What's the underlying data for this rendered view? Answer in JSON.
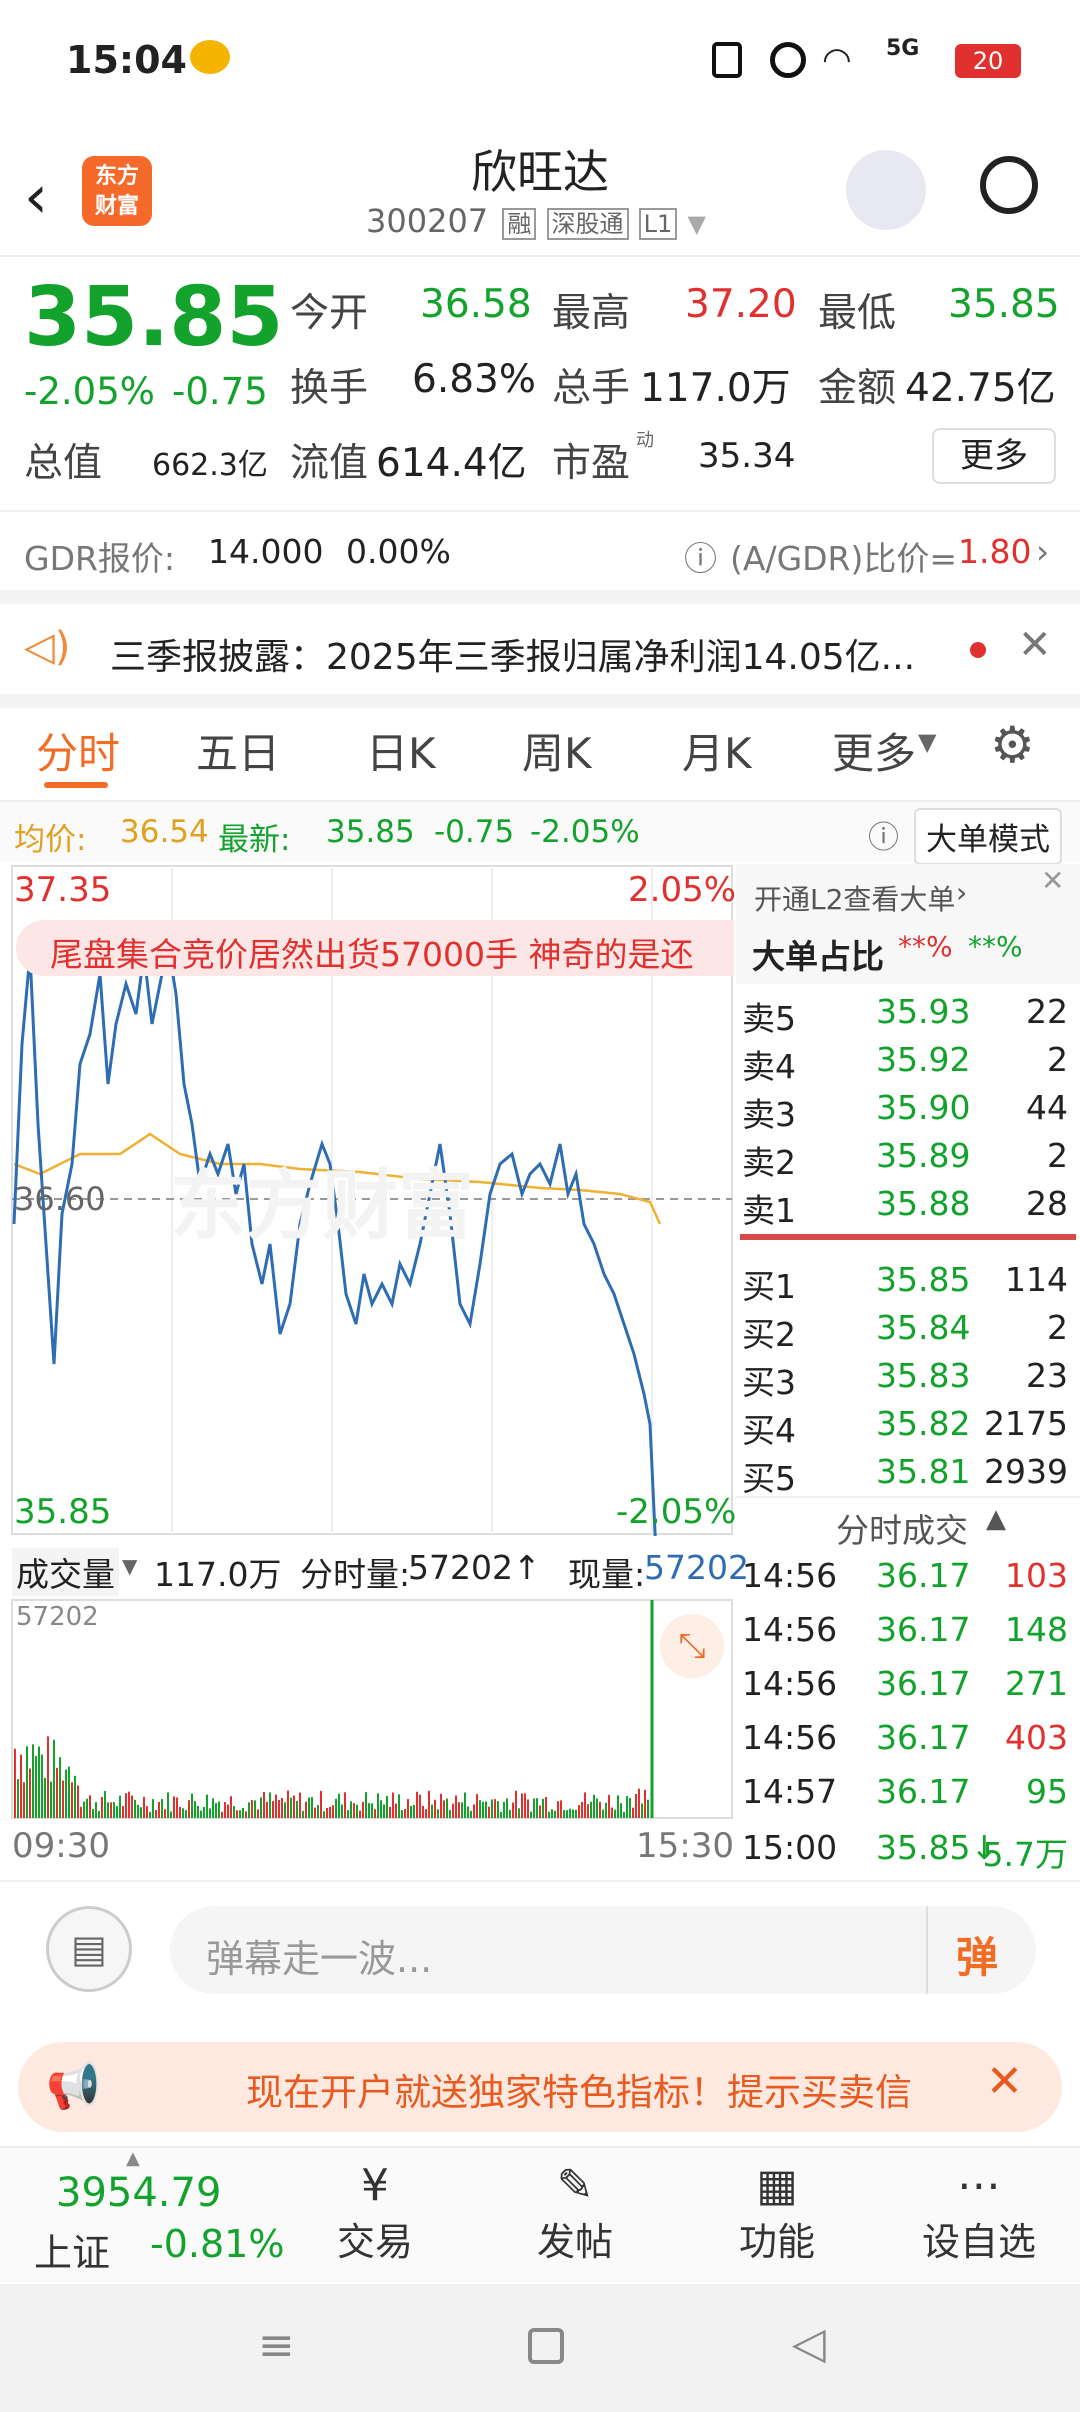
{
  "status": {
    "time": "15:04",
    "battery": "20",
    "net": "5G"
  },
  "nav": {
    "title": "欣旺达",
    "code": "300207",
    "tags": [
      "融",
      "深股通",
      "L1"
    ],
    "logo": "东方\n财富"
  },
  "quote": {
    "price": "35.85",
    "pct": "-2.05%",
    "chg": "-0.75",
    "open_label": "今开",
    "open": "36.58",
    "high_label": "最高",
    "high": "37.20",
    "low_label": "最低",
    "low": "35.85",
    "turnover_label": "换手",
    "turnover": "6.83%",
    "vol_label": "总手",
    "vol": "117.0万",
    "amt_label": "金额",
    "amt": "42.75亿",
    "mcap_label": "总值",
    "mcap": "662.3亿",
    "float_label": "流值",
    "float": "614.4亿",
    "pe_label": "市盈",
    "pe_sup": "动",
    "pe": "35.34",
    "more": "更多"
  },
  "gdr": {
    "label": "GDR报价:",
    "price": "14.000",
    "pct": "0.00%",
    "ratio_label": "(A/GDR)比价=",
    "ratio": "1.80"
  },
  "notice": {
    "text": "三季报披露：2025年三季报归属净利润14.05亿..."
  },
  "tabs": [
    "分时",
    "五日",
    "日K",
    "周K",
    "月K",
    "更多"
  ],
  "summary": {
    "avg_label": "均价:",
    "avg": "36.54",
    "last_label": "最新:",
    "last": "35.85",
    "chg": "-0.75",
    "pct": "-2.05%",
    "mode": "大单模式"
  },
  "chart": {
    "ymax": "37.35",
    "ymin": "35.85",
    "pmax": "2.05%",
    "pmin": "-2.05%",
    "mid": "36.60",
    "ticker": "尾盘集合竞价居然出货57000手 神奇的是还",
    "watermark": "东方财富",
    "t_start": "09:30",
    "t_end": "15:30"
  },
  "vol": {
    "label": "成交量",
    "total": "117.0万",
    "fs_label": "分时量:",
    "fs": "57202↑",
    "now_label": "现量:",
    "now": "57202",
    "max": "57202"
  },
  "big": {
    "l2": "开通L2查看大单",
    "ratio_label": "大单占比",
    "r1": "**%",
    "r2": "**%"
  },
  "sells": [
    [
      "卖5",
      "35.93",
      "22"
    ],
    [
      "卖4",
      "35.92",
      "2"
    ],
    [
      "卖3",
      "35.90",
      "44"
    ],
    [
      "卖2",
      "35.89",
      "2"
    ],
    [
      "卖1",
      "35.88",
      "28"
    ]
  ],
  "buys": [
    [
      "买1",
      "35.85",
      "114"
    ],
    [
      "买2",
      "35.84",
      "2"
    ],
    [
      "买3",
      "35.83",
      "23"
    ],
    [
      "买4",
      "35.82",
      "2175"
    ],
    [
      "买5",
      "35.81",
      "2939"
    ]
  ],
  "ticks_title": "分时成交",
  "ticks": [
    [
      "14:56",
      "36.17",
      "103",
      "r"
    ],
    [
      "14:56",
      "36.17",
      "148",
      "g"
    ],
    [
      "14:56",
      "36.17",
      "271",
      "g"
    ],
    [
      "14:56",
      "36.17",
      "403",
      "r"
    ],
    [
      "14:57",
      "36.17",
      "95",
      "g"
    ],
    [
      "15:00",
      "35.85↓",
      "5.7万",
      "g"
    ]
  ],
  "danmu": {
    "placeholder": "弹幕走一波...",
    "btn": "弹"
  },
  "promo": {
    "text": "现在开户就送独家特色指标！提示买卖信"
  },
  "bottom": {
    "index": "3954.79",
    "index_name": "上证",
    "index_pct": "-0.81%",
    "items": [
      "交易",
      "发帖",
      "功能",
      "设自选"
    ]
  }
}
